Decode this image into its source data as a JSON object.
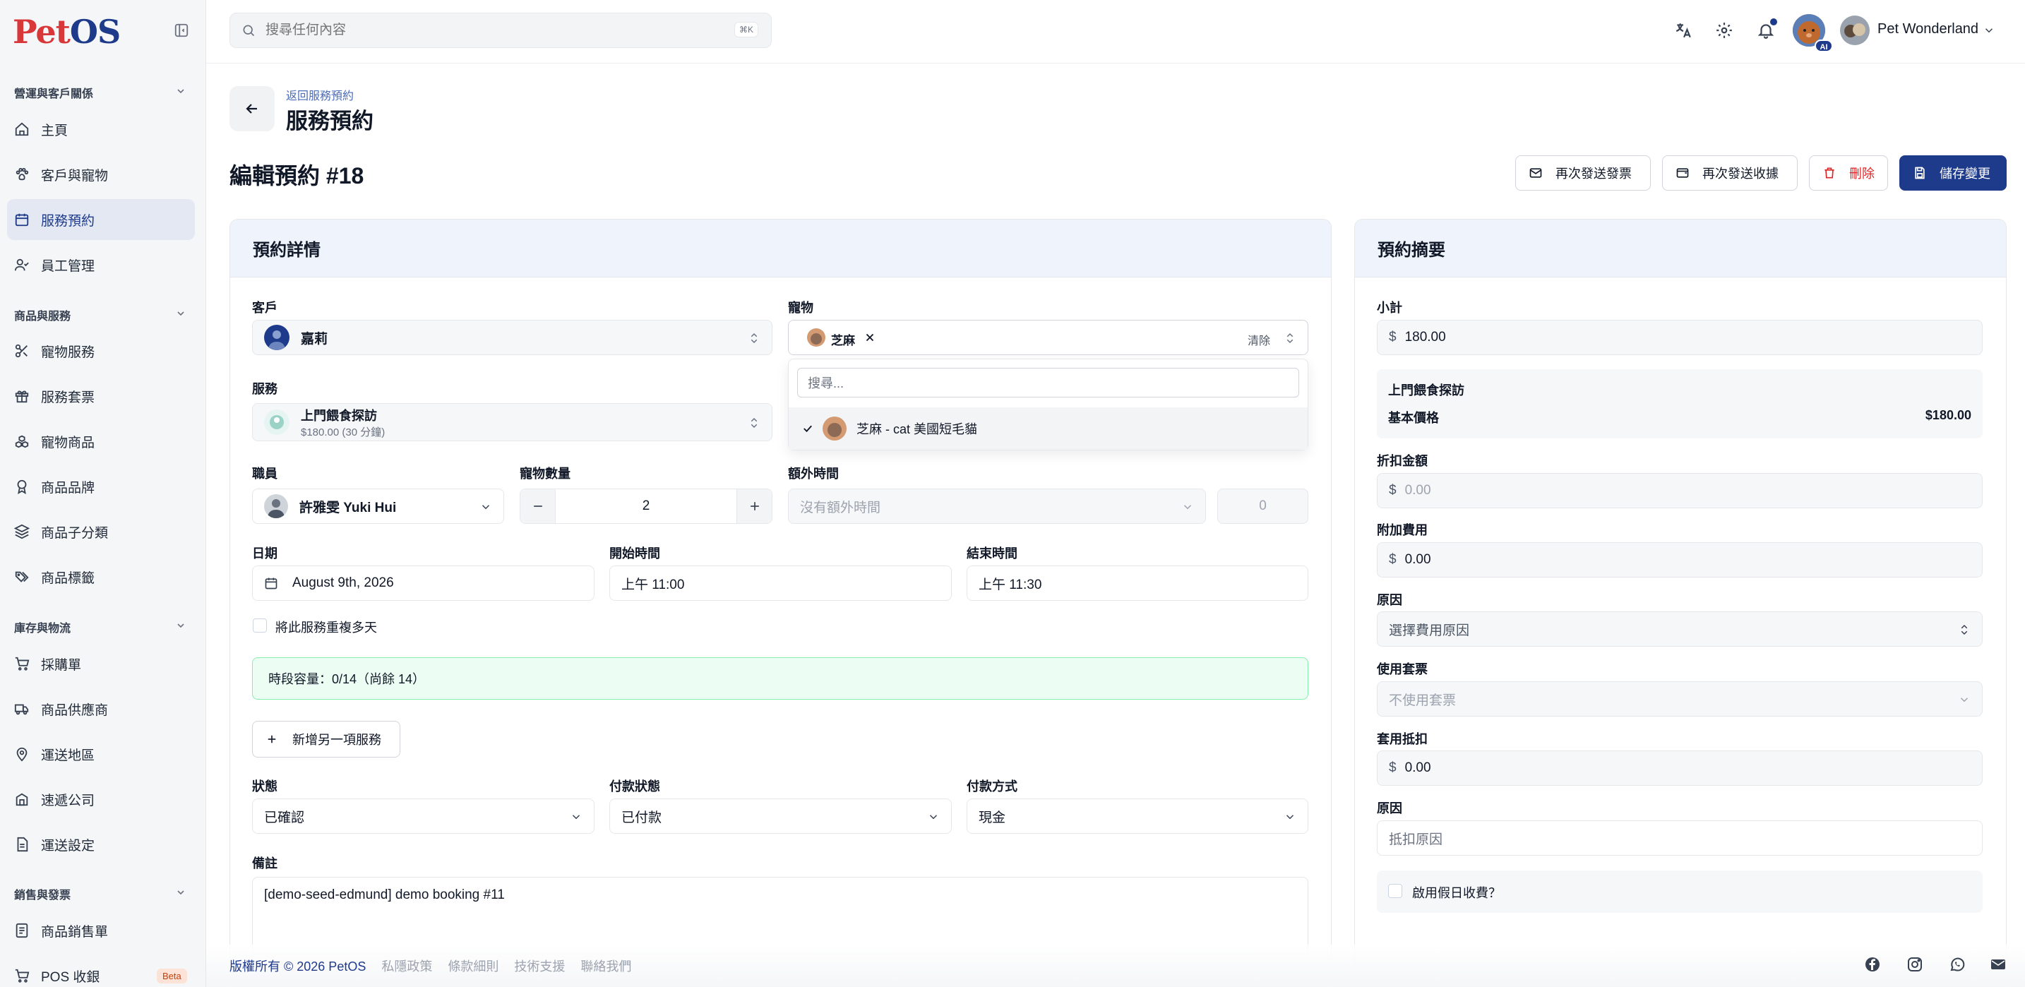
{
  "brand": {
    "logo_p": "P",
    "logo_rest": "et",
    "logo_os": "OS",
    "accent": "#1e3a8a",
    "logo_red": "#d9383a"
  },
  "sidebar": {
    "groups": [
      {
        "title": "營運與客戶關係",
        "items": [
          {
            "label": "主頁",
            "icon": "home-icon"
          },
          {
            "label": "客戶與寵物",
            "icon": "paw-icon"
          },
          {
            "label": "服務預約",
            "icon": "calendar-icon",
            "active": true
          },
          {
            "label": "員工管理",
            "icon": "user-check-icon"
          }
        ]
      },
      {
        "title": "商品與服務",
        "items": [
          {
            "label": "寵物服務",
            "icon": "scissors-icon"
          },
          {
            "label": "服務套票",
            "icon": "gift-icon"
          },
          {
            "label": "寵物商品",
            "icon": "boxes-icon"
          },
          {
            "label": "商品品牌",
            "icon": "award-icon"
          },
          {
            "label": "商品子分類",
            "icon": "layers-icon"
          },
          {
            "label": "商品標籤",
            "icon": "tags-icon"
          }
        ]
      },
      {
        "title": "庫存與物流",
        "items": [
          {
            "label": "採購單",
            "icon": "cart-icon"
          },
          {
            "label": "商品供應商",
            "icon": "truck-icon"
          },
          {
            "label": "運送地區",
            "icon": "map-pin-icon"
          },
          {
            "label": "速遞公司",
            "icon": "building-icon"
          },
          {
            "label": "運送設定",
            "icon": "file-settings-icon"
          }
        ]
      },
      {
        "title": "銷售與發票",
        "items": [
          {
            "label": "商品銷售單",
            "icon": "receipt-icon"
          },
          {
            "label": "POS 收銀",
            "icon": "pos-cart-icon"
          }
        ]
      }
    ],
    "beta_label": "Beta"
  },
  "topbar": {
    "search_placeholder": "搜尋任何內容",
    "search_shortcut": "⌘K",
    "ai_badge": "AI",
    "user_name": "Pet Wonderland"
  },
  "header": {
    "breadcrumb": "返回服務預約",
    "title": "服務預約",
    "edit_title": "編輯預約 #18",
    "buttons": {
      "resend_invoice": "再次發送發票",
      "resend_receipt": "再次發送收據",
      "delete": "刪除",
      "save": "儲存變更"
    }
  },
  "details": {
    "title": "預約詳情",
    "customer_label": "客戶",
    "customer_value": "嘉莉",
    "pet_label": "寵物",
    "pet_chip": "芝麻",
    "pet_clear": "清除",
    "pet_search_placeholder": "搜尋...",
    "pet_option": "芝麻 - cat 美國短毛貓",
    "service_label": "服務",
    "service_name": "上門餵食探訪",
    "service_sub": "$180.00 (30 分鐘)",
    "staff_label": "職員",
    "staff_value": "許雅雯 Yuki Hui",
    "pet_count_label": "寵物數量",
    "pet_count_value": "2",
    "extra_time_label": "額外時間",
    "extra_time_placeholder": "沒有額外時間",
    "extra_time_value": "0",
    "date_label": "日期",
    "date_value": "August 9th, 2026",
    "start_label": "開始時間",
    "start_value": "上午 11:00",
    "end_label": "結束時間",
    "end_value": "上午 11:30",
    "repeat_label": "將此服務重複多天",
    "capacity_text": "時段容量：0/14（尚餘 14）",
    "add_service_label": "新增另一項服務",
    "status_label": "狀態",
    "status_value": "已確認",
    "payment_status_label": "付款狀態",
    "payment_status_value": "已付款",
    "payment_method_label": "付款方式",
    "payment_method_value": "現金",
    "notes_label": "備註",
    "notes_value": "[demo-seed-edmund] demo booking #11"
  },
  "summary": {
    "title": "預約摘要",
    "subtotal_label": "小計",
    "currency": "$",
    "subtotal_value": "180.00",
    "service_name": "上門餵食探訪",
    "base_price_label": "基本價格",
    "base_price_value": "$180.00",
    "discount_label": "折扣金額",
    "discount_placeholder": "0.00",
    "surcharge_label": "附加費用",
    "surcharge_value": "0.00",
    "reason_label": "原因",
    "reason_placeholder": "選擇費用原因",
    "package_label": "使用套票",
    "package_placeholder": "不使用套票",
    "package_offset_label": "套用抵扣",
    "package_offset_value": "0.00",
    "offset_reason_label": "原因",
    "offset_reason_placeholder": "抵扣原因",
    "holiday_label": "啟用假日收費？"
  },
  "footer": {
    "copyright": "版權所有 © 2026 PetOS",
    "links": [
      "私隱政策",
      "條款細則",
      "技術支援",
      "聯絡我們"
    ]
  }
}
